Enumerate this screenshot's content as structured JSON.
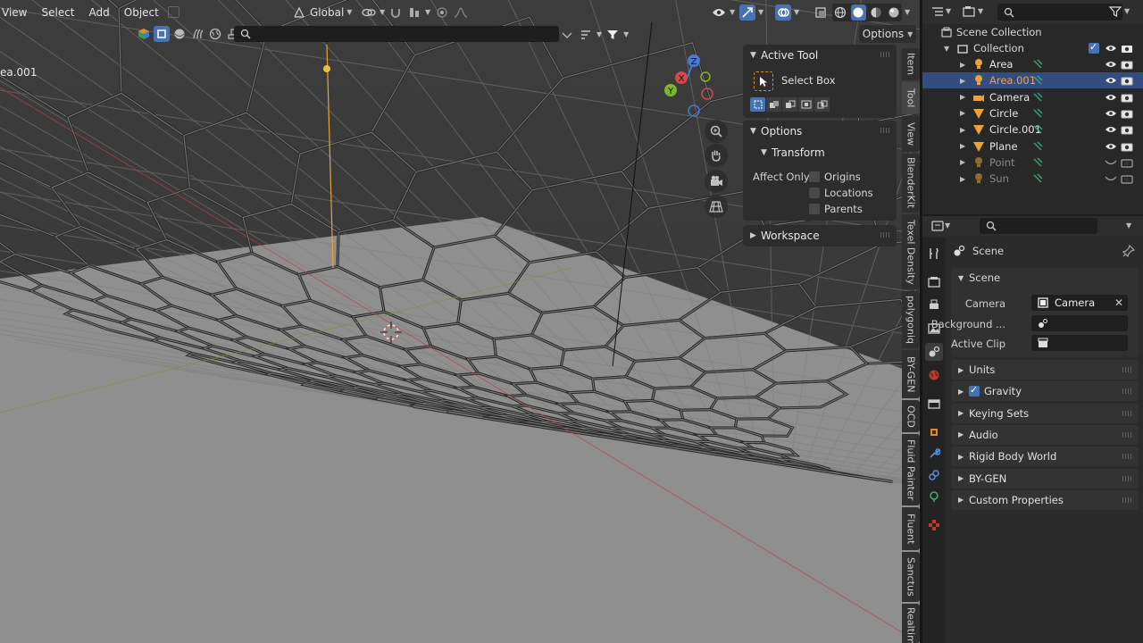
{
  "header": {
    "menus": [
      "View",
      "Select",
      "Add",
      "Object"
    ],
    "transform_orientation": "Global",
    "options_label": "Options"
  },
  "viewport": {
    "object_name": "ea.001"
  },
  "npanel": {
    "active_tool": {
      "title": "Active Tool",
      "tool_name": "Select Box"
    },
    "options": {
      "title": "Options",
      "transform": "Transform",
      "affect_only": "Affect Only",
      "checkboxes": [
        {
          "label": "Origins",
          "checked": false
        },
        {
          "label": "Locations",
          "checked": false
        },
        {
          "label": "Parents",
          "checked": false
        }
      ]
    },
    "workspace": "Workspace",
    "tabs": [
      "Item",
      "Tool",
      "View",
      "BlenderKit",
      "Texel Density",
      "polygoniq",
      "BY-GEN",
      "OCD",
      "Fluid Painter",
      "Fluent",
      "Sanctus",
      "Realtim"
    ]
  },
  "outliner": {
    "scene_collection": "Scene Collection",
    "collection": "Collection",
    "items": [
      {
        "name": "Area",
        "icon": "light-icon",
        "selected": false,
        "dim": false
      },
      {
        "name": "Area.001",
        "icon": "light-icon",
        "selected": true,
        "dim": false
      },
      {
        "name": "Camera",
        "icon": "camera-icon",
        "selected": false,
        "dim": false
      },
      {
        "name": "Circle",
        "icon": "mesh-icon",
        "selected": false,
        "dim": false
      },
      {
        "name": "Circle.001",
        "icon": "mesh-icon",
        "selected": false,
        "dim": false
      },
      {
        "name": "Plane",
        "icon": "mesh-icon",
        "selected": false,
        "dim": false
      },
      {
        "name": "Point",
        "icon": "light-icon",
        "selected": false,
        "dim": true
      },
      {
        "name": "Sun",
        "icon": "light-icon",
        "selected": false,
        "dim": true
      }
    ]
  },
  "properties": {
    "context": "Scene",
    "panel": "Scene",
    "camera_label": "Camera",
    "camera_value": "Camera",
    "background_label": "Background ...",
    "active_clip_label": "Active Clip",
    "sections": [
      "Units",
      "Gravity",
      "Keying Sets",
      "Audio",
      "Rigid Body World",
      "BY-GEN",
      "Custom Properties"
    ]
  },
  "colors": {
    "accent": "#4772b3",
    "selection": "#334d80",
    "light": "#e8a23a"
  }
}
